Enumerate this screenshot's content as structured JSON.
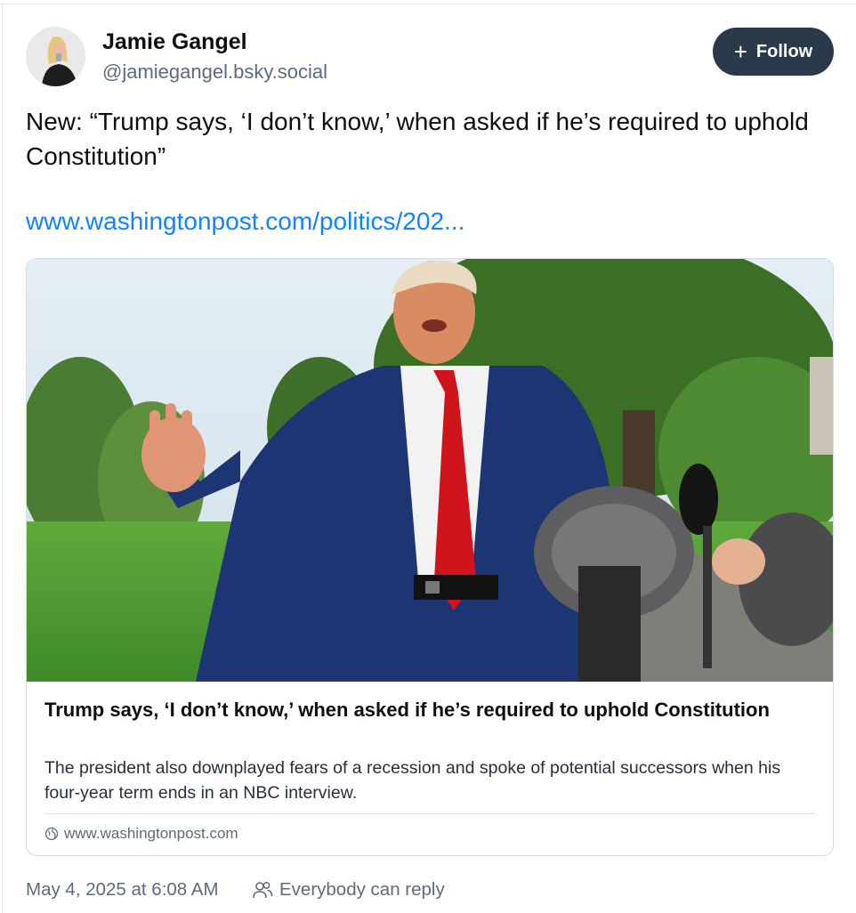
{
  "author": {
    "display_name": "Jamie Gangel",
    "handle": "@jamiegangel.bsky.social",
    "avatar_icon": "person-avatar"
  },
  "follow_button": {
    "icon": "plus-icon",
    "label": "Follow",
    "background": "#2a3a4b"
  },
  "post": {
    "text": "New: “Trump says, ‘I don’t know,’ when asked if he’s required to uphold Constitution”",
    "link_text": "www.washingtonpost.com/politics/202...",
    "link_color": "#1083fe"
  },
  "link_card": {
    "image_icon": "article-photo",
    "title": "Trump says, ‘I don’t know,’ when asked if he’s required to uphold Constitution",
    "description": "The president also downplayed fears of a recession and spoke of potential successors when his four-year term ends in an NBC interview.",
    "domain_icon": "globe-icon",
    "domain": "www.washingtonpost.com"
  },
  "footer": {
    "timestamp": "May 4, 2025 at 6:08 AM",
    "reply_icon": "people-icon",
    "reply_setting": "Everybody can reply"
  }
}
